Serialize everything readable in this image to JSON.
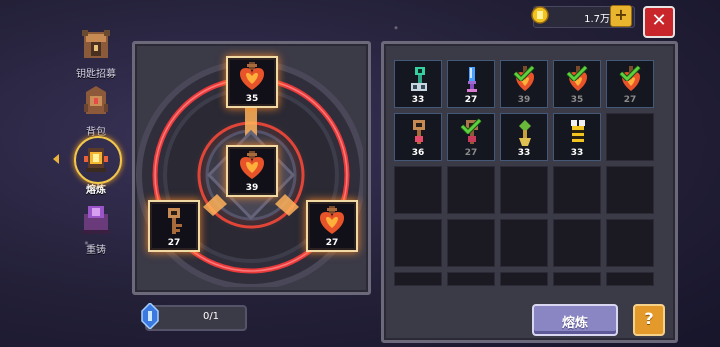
{
  "sidebar": {
    "items": [
      {
        "label": "钥匙招募",
        "icon": "key-recruit-icon"
      },
      {
        "label": "背包",
        "icon": "backpack-icon"
      },
      {
        "label": "熔炼",
        "icon": "smelt-icon",
        "active": true
      },
      {
        "label": "重铸",
        "icon": "recast-icon"
      }
    ]
  },
  "currency": {
    "amount": "1.7万",
    "icon": "gold-coin-icon"
  },
  "forge": {
    "slots": {
      "top": {
        "count": "35",
        "icon": "heart-key-icon"
      },
      "center": {
        "count": "39",
        "icon": "heart-key-icon"
      },
      "left": {
        "count": "27",
        "icon": "bronze-key-icon"
      },
      "right": {
        "count": "27",
        "icon": "heart-key-icon"
      }
    },
    "crystal": {
      "count": "0/1",
      "icon": "blue-crystal-icon"
    }
  },
  "inventory": {
    "items": [
      {
        "count": "33",
        "icon": "green-gear-key-icon",
        "checked": false
      },
      {
        "count": "27",
        "icon": "blue-crystal-key-icon",
        "checked": false
      },
      {
        "count": "39",
        "icon": "heart-key-icon",
        "checked": true
      },
      {
        "count": "35",
        "icon": "heart-key-icon",
        "checked": true
      },
      {
        "count": "27",
        "icon": "heart-key-icon",
        "checked": true
      },
      {
        "count": "36",
        "icon": "bronze-key-icon",
        "checked": false
      },
      {
        "count": "27",
        "icon": "bronze-key-icon",
        "checked": true
      },
      {
        "count": "33",
        "icon": "leaf-key-icon",
        "checked": false
      },
      {
        "count": "33",
        "icon": "bee-key-icon",
        "checked": false
      }
    ]
  },
  "buttons": {
    "smelt": "熔炼",
    "help": "?",
    "close": "✕",
    "plus": "+"
  },
  "colors": {
    "accent_red": "#c8262b",
    "ring_glow": "#ff5a3c",
    "smelt_button": "#8a86c4",
    "help_button": "#e49a2a",
    "check_green": "#5bd13e"
  }
}
